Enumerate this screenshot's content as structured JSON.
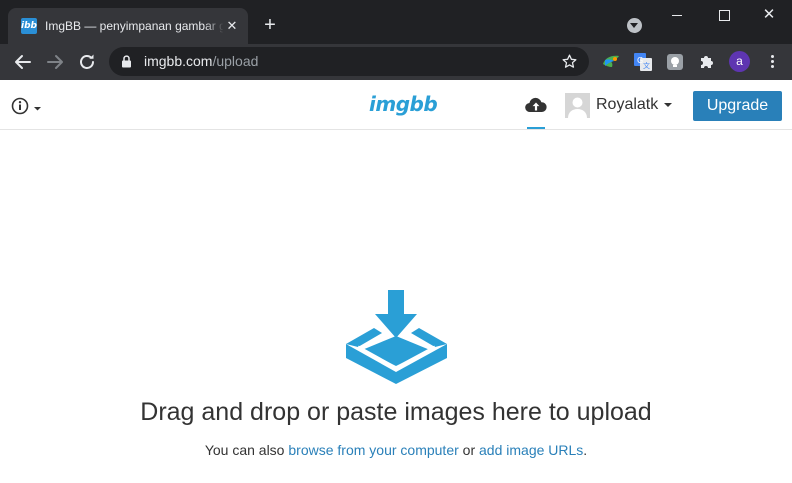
{
  "browser": {
    "tab": {
      "title": "ImgBB — penyimpanan gambar gratis",
      "favicon": "ibb",
      "close_glyph": "✕"
    },
    "new_tab_glyph": "+",
    "window_close_glyph": "✕",
    "url": {
      "host": "imgbb.com",
      "path": "/upload"
    },
    "profile_initial": "a",
    "icons": [
      "back-icon",
      "forward-icon",
      "reload-icon",
      "lock-icon",
      "star-icon",
      "extension-icon",
      "translate-icon",
      "puzzle-icon",
      "menu-icon"
    ]
  },
  "site": {
    "logo": "imgbb",
    "user": {
      "name": "Royalatk"
    },
    "upgrade_label": "Upgrade"
  },
  "upload": {
    "title": "Drag and drop or paste images here to upload",
    "sub_prefix": "You can also ",
    "browse_link": "browse from your computer",
    "sub_or": " or ",
    "url_link": "add image URLs",
    "sub_suffix": "."
  },
  "colors": {
    "accent": "#2a9fd6",
    "upgrade_button": "#2980b9",
    "chrome_dark": "#202124",
    "chrome_toolbar": "#35363a"
  }
}
